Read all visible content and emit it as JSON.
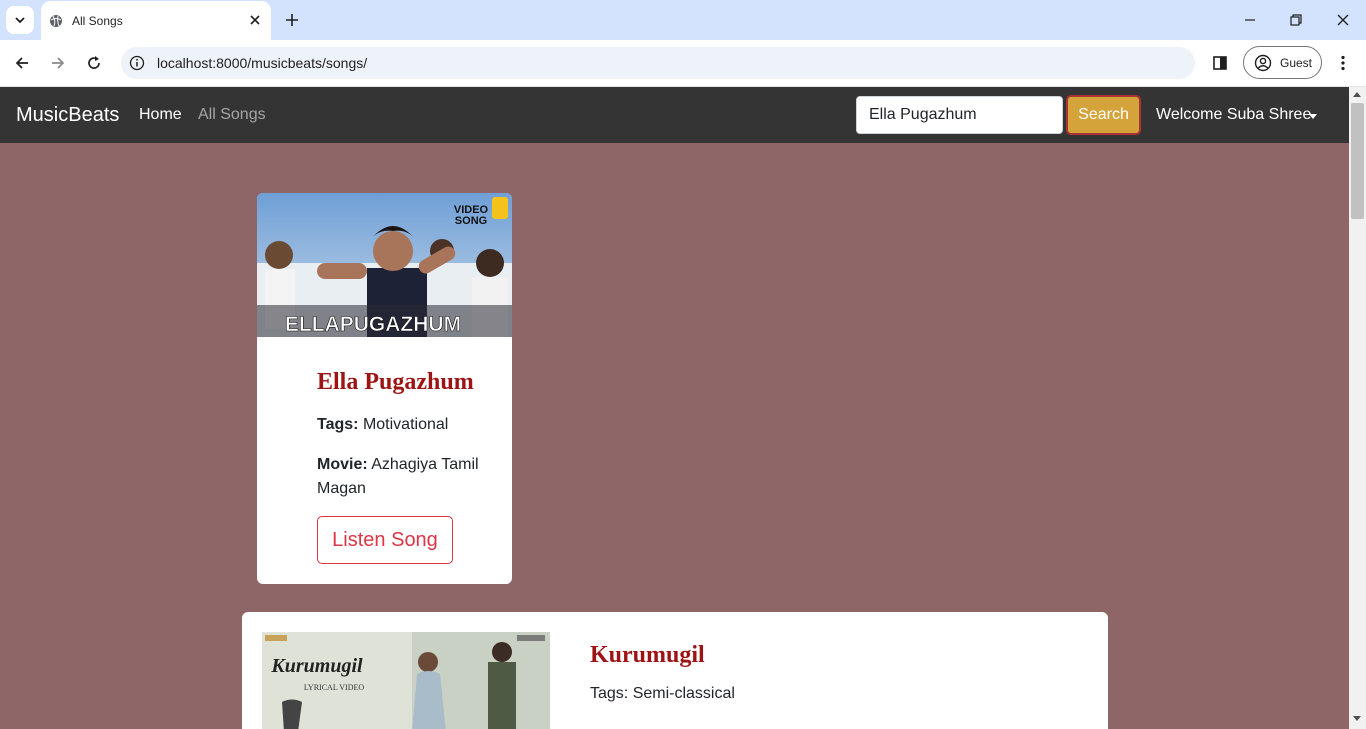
{
  "browser": {
    "tab_title": "All Songs",
    "url": "localhost:8000/musicbeats/songs/",
    "profile_label": "Guest"
  },
  "navbar": {
    "brand": "MusicBeats",
    "links": [
      {
        "label": "Home",
        "active": true
      },
      {
        "label": "All Songs",
        "active": false
      }
    ],
    "search_value": "Ella Pugazhum",
    "search_button": "Search",
    "user_menu": "Welcome Suba Shree"
  },
  "songs": [
    {
      "title": "Ella Pugazhum",
      "tags_label": "Tags:",
      "tags": "Motivational",
      "movie_label": "Movie:",
      "movie": "Azhagiya Tamil Magan",
      "button": "Listen Song",
      "thumbnail_text": "ELLAPUGAZHUM",
      "thumbnail_badge": "VIDEO SONG"
    },
    {
      "title": "Kurumugil",
      "tags_text": "Tags: Semi-classical",
      "thumbnail_text": "Kurumugil",
      "thumbnail_sub": "LYRICAL VIDEO"
    }
  ],
  "colors": {
    "page_background": "#8e6667",
    "navbar": "#343434",
    "title_red": "#9e1414",
    "search_button": "#d4a43b",
    "listen_button": "#dc3545"
  }
}
